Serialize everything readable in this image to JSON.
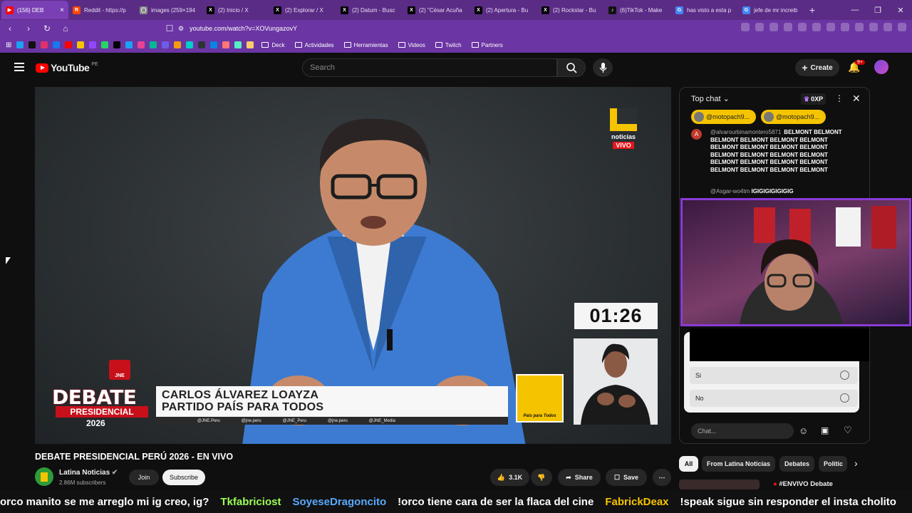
{
  "browser": {
    "tabs": [
      {
        "label": "(156) DEB",
        "fav_color": "#ff0000",
        "fav": "▶",
        "active": true
      },
      {
        "label": "Reddit - https://p",
        "fav_color": "#ff4500",
        "fav": "R"
      },
      {
        "label": "images (259×194",
        "fav_color": "#888888",
        "fav": "◯"
      },
      {
        "label": "(2) Inicio / X",
        "fav_color": "#000000",
        "fav": "X"
      },
      {
        "label": "(2) Explorar / X",
        "fav_color": "#000000",
        "fav": "X"
      },
      {
        "label": "(2) Datum - Busc",
        "fav_color": "#000000",
        "fav": "X"
      },
      {
        "label": "(2) \"César Acuña",
        "fav_color": "#000000",
        "fav": "X"
      },
      {
        "label": "(2) Apertura - Bu",
        "fav_color": "#000000",
        "fav": "X"
      },
      {
        "label": "(2) Rockstar - Bu",
        "fav_color": "#000000",
        "fav": "X"
      },
      {
        "label": "(6)TikTok - Make",
        "fav_color": "#111111",
        "fav": "♪"
      },
      {
        "label": "has visto a esta p",
        "fav_color": "#4285f4",
        "fav": "G"
      },
      {
        "label": "jefe de mr increib",
        "fav_color": "#4285f4",
        "fav": "G"
      }
    ],
    "url": "youtube.com/watch?v=XOVungazovY",
    "bookmarks": [
      "Deck",
      "Actividades",
      "Herramientas",
      "Videos",
      "Twitch",
      "Partners"
    ],
    "bookmark_icon_colors": [
      "#1da1f2",
      "#111111",
      "#e1306c",
      "#1877f2",
      "#ff0000",
      "#f5c400",
      "#9146ff",
      "#25d366",
      "#000000",
      "#1da1f2",
      "#e84393",
      "#00b894",
      "#6c5ce7",
      "#f39c12",
      "#00cec9",
      "#2d3436",
      "#0984e3",
      "#ff7675",
      "#55efc4",
      "#fdcb6e"
    ]
  },
  "youtube": {
    "logo_text": "YouTube",
    "country": "PE",
    "search_placeholder": "Search",
    "create_label": "Create",
    "notif_count": "9+"
  },
  "video": {
    "channel_badge_top": "noticias",
    "live_badge": "VIVO",
    "timer": "01:26",
    "lower_name": "CARLOS ÁLVAREZ LOAYZA",
    "lower_party": "PARTIDO PAÍS PARA TODOS",
    "social": [
      "@JNE.Peru",
      "@jne.peru",
      "@JNE_Peru",
      "@jne.peru",
      "@JNE_Media"
    ],
    "jne_label": "JNE",
    "debate_title": "DEBATE",
    "debate_sub": "PRESIDENCIAL",
    "debate_year": "2026",
    "party_logo_text": "País para Todos"
  },
  "meta": {
    "title": "DEBATE PRESIDENCIAL PERÚ 2026 - EN VIVO",
    "channel": "Latina Noticias",
    "subscribers": "2.86M subscribers",
    "join": "Join",
    "subscribe": "Subscribe",
    "likes": "3.1K",
    "share": "Share",
    "save": "Save"
  },
  "chat": {
    "header": "Top chat",
    "xp": "0XP",
    "pinned": [
      "@motopach9...",
      "@motopach9..."
    ],
    "msg1_avatar": "A",
    "msg1_author": "@alvarourbinamontero5871",
    "msg1_text": "BELMONT BELMONT BELMONT BELMONT BELMONT BELMONT BELMONT BELMONT BELMONT BELMONT BELMONT BELMONT BELMONT BELMONT BELMONT BELMONT BELMONT BELMONT BELMONT BELMONT BELMONT BELMONT",
    "msg2_author": "@Asgar-wo4tm",
    "msg2_text": "IGIGIGIGIGIGIG",
    "poll_options": [
      "Si",
      "No"
    ],
    "input_placeholder": "Chat..."
  },
  "chips": [
    "All",
    "From Latina Noticias",
    "Debates",
    "Politic"
  ],
  "related_title": "#ENVIVO Debate",
  "ticker": [
    {
      "user": "",
      "msg": "orco manito se me arreglo mi ig creo, ig?",
      "color": "#ffffff"
    },
    {
      "user": "Tkfabriciost",
      "msg": "",
      "color": "#9cff57"
    },
    {
      "user": "SoyeseDragoncito",
      "msg": "!orco tiene cara de ser la flaca del cine",
      "color": "#5aa9ff"
    },
    {
      "user": "FabrickDeax",
      "msg": "!speak sigue sin responder el insta cholito",
      "color": "#f5c400"
    }
  ]
}
